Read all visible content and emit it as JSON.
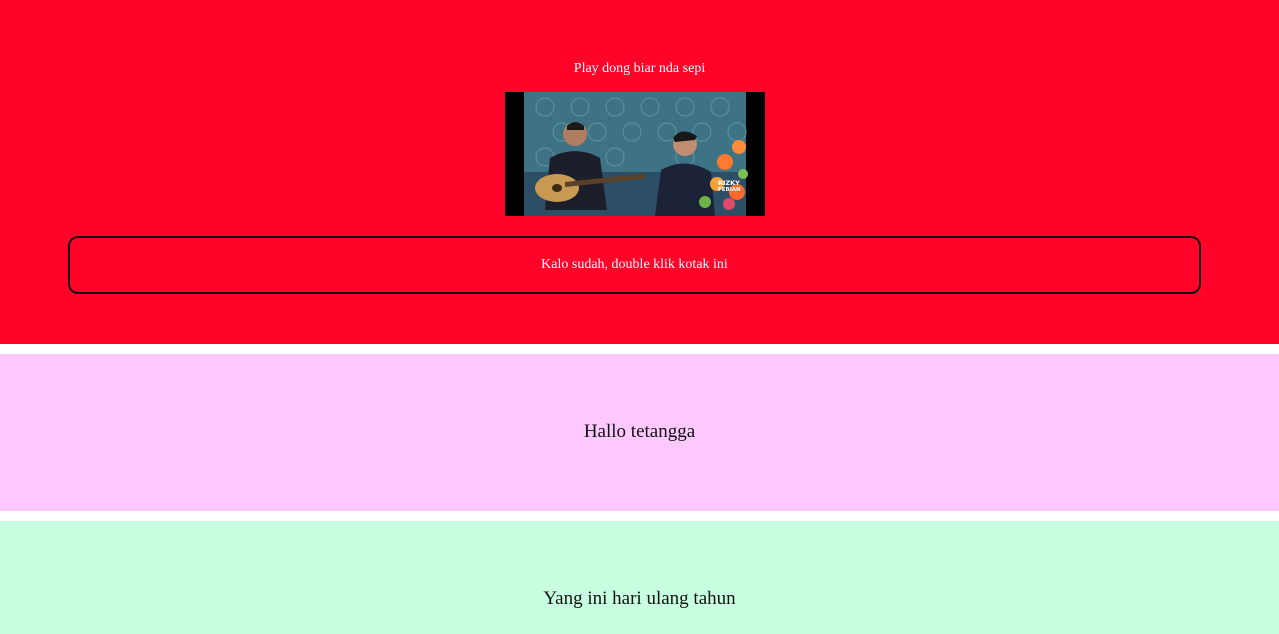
{
  "intro": {
    "text": "Play dong biar nda sepi"
  },
  "video": {
    "thumbnail_icon": "video-thumbnail",
    "watermark": "RIZKY FEBIAN"
  },
  "double_click_box": {
    "text": "Kalo sudah, double klik kotak ini"
  },
  "sections": {
    "pink": {
      "text": "Hallo tetangga"
    },
    "green": {
      "text": "Yang ini hari ulang tahun"
    }
  },
  "colors": {
    "red_section": "#ff0328",
    "pink_section": "#ffc8ff",
    "green_section": "#c8ffe1",
    "divider": "#ffffff"
  }
}
